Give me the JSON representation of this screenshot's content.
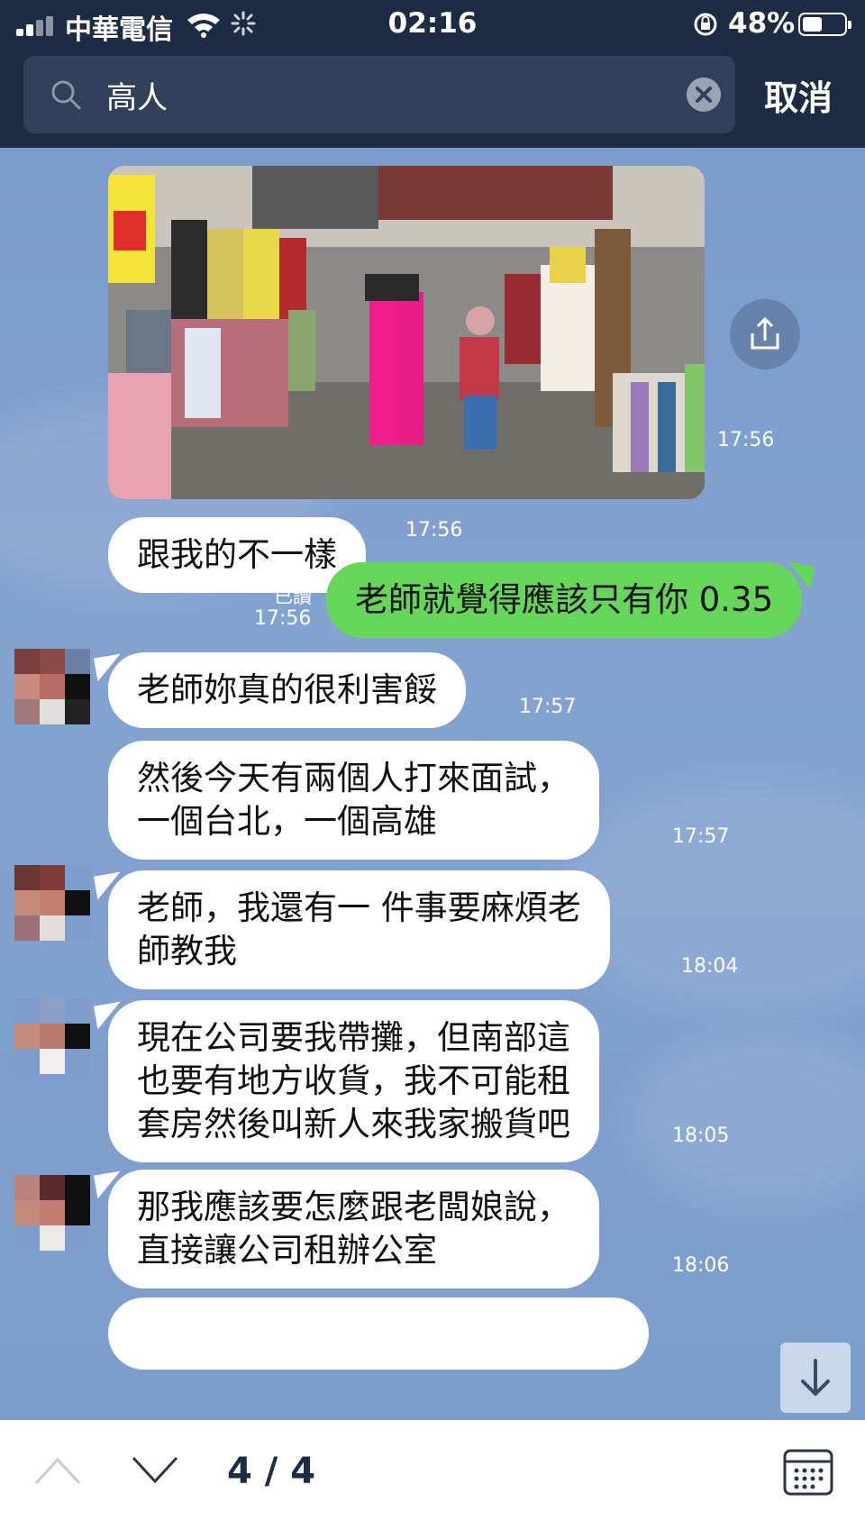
{
  "status_bar": {
    "carrier": "中華電信",
    "time": "02:16",
    "battery_percent": "48%",
    "battery_level": 0.48
  },
  "search": {
    "query": "高人",
    "cancel_label": "取消"
  },
  "messages": [
    {
      "time": "17:56"
    },
    {
      "text": "跟我的不一樣",
      "time": "17:56"
    },
    {
      "text": "老師就覺得應該只有你 0.35",
      "time": "17:56",
      "read_label": "已讀"
    },
    {
      "text": "老師妳真的很利害餒",
      "time": "17:57"
    },
    {
      "text": "然後今天有兩個人打來面試，\n一個台北，一個高雄",
      "time": "17:57"
    },
    {
      "text": "老師，我還有一 件事要麻煩老\n師教我",
      "time": "18:04"
    },
    {
      "text": "現在公司要我帶攤，但南部這\n也要有地方收貨，我不可能租\n套房然後叫新人來我家搬貨吧",
      "time": "18:05"
    },
    {
      "text": "那我應該要怎麼跟老闆娘說，\n直接讓公司租辦公室",
      "time": "18:06"
    }
  ],
  "navigation": {
    "page_counter": "4 / 4"
  },
  "colors": {
    "header_bg": "#1e2b45",
    "chat_bg": "#7f9fcf",
    "sent_bubble": "#65d65a",
    "received_bubble": "#ffffff"
  },
  "icons": [
    "search-icon",
    "clear-icon",
    "share-icon",
    "chevron-up-icon",
    "chevron-down-icon",
    "calendar-icon",
    "arrow-down-icon"
  ]
}
